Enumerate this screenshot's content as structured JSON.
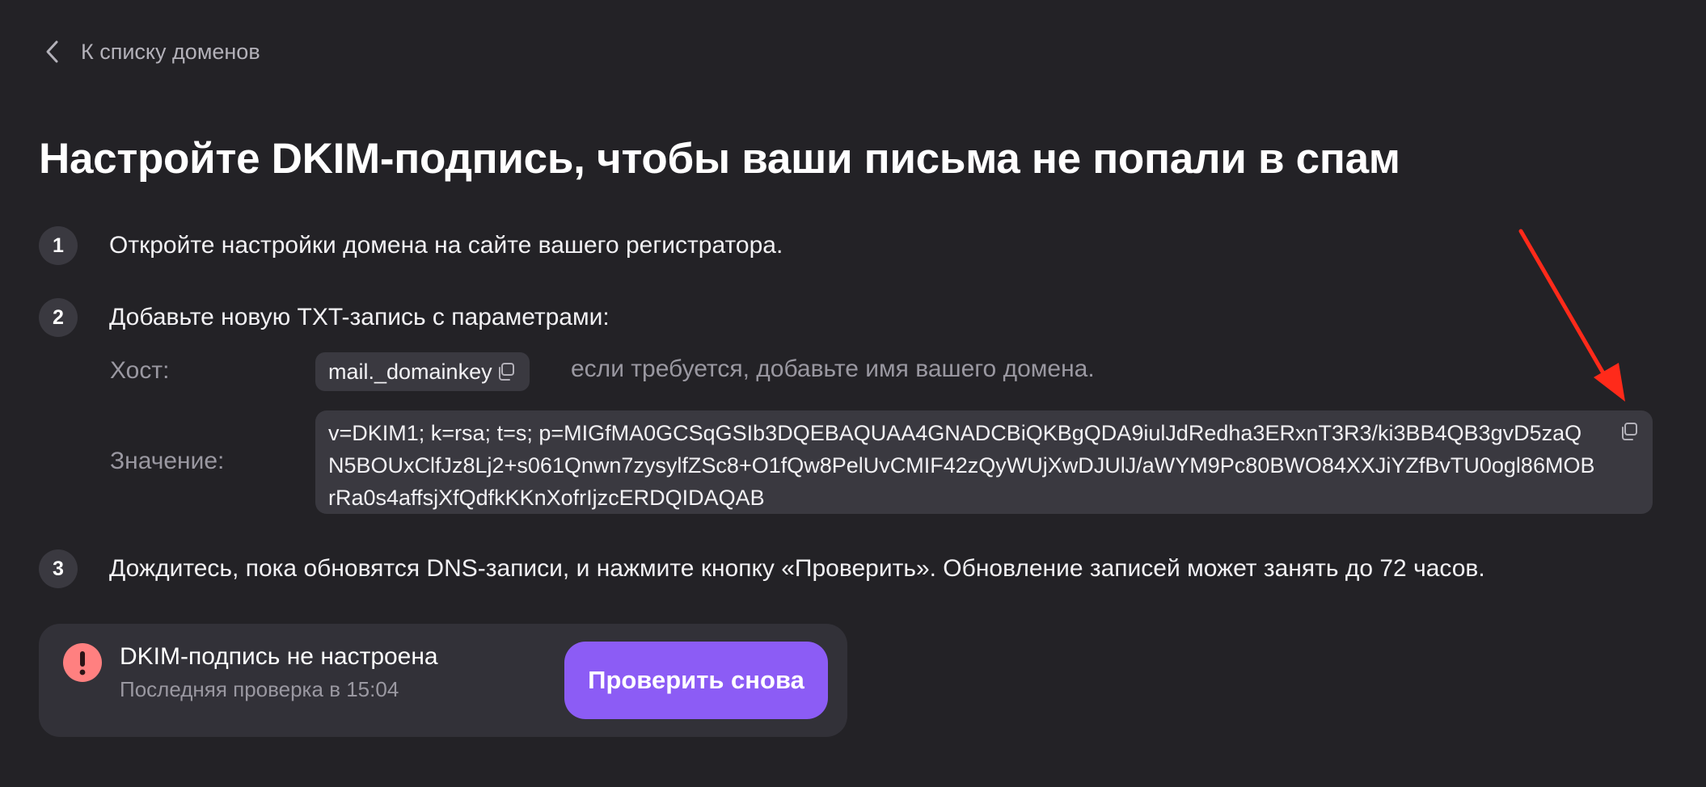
{
  "nav": {
    "back_label": "К списку доменов"
  },
  "page": {
    "title": "Настройте DKIM-подпись, чтобы ваши письма не попали в спам"
  },
  "steps": [
    {
      "number": "1",
      "text": "Откройте настройки домена на сайте вашего регистратора."
    },
    {
      "number": "2",
      "text": "Добавьте новую TXT-запись с параметрами:"
    },
    {
      "number": "3",
      "text": "Дождитесь, пока обновятся DNS-записи, и нажмите кнопку «Проверить». Обновление записей может занять до 72 часов."
    }
  ],
  "record": {
    "host_label": "Хост:",
    "host_value": "mail._domainkey",
    "host_hint": "если требуется, добавьте имя вашего домена.",
    "value_label": "Значение:",
    "value": "v=DKIM1; k=rsa; t=s; p=MIGfMA0GCSqGSIb3DQEBAQUAA4GNADCBiQKBgQDA9iulJdRedha3ERxnT3R3/ki3BB4QB3gvD5zaQN5BOUxClfJz8Lj2+s061Qnwn7zysylfZSc8+O1fQw8PelUvCMIF42zQyWUjXwDJUlJ/aWYM9Pc80BWO84XXJiYZfBvTU0ogl86MOBrRa0s4affsjXfQdfkKKnXofrIjzcERDQIDAQAB"
  },
  "status": {
    "title": "DKIM-подпись не настроена",
    "subtitle": "Последняя проверка в 15:04",
    "button_label": "Проверить снова"
  },
  "icons": {
    "back": "chevron-left-icon",
    "copy": "copy-icon",
    "alert": "exclamation-circle-icon"
  },
  "colors": {
    "background": "#232226",
    "surface": "#3a3940",
    "card": "#323138",
    "accent": "#8c5cf5",
    "error": "#ff8080",
    "annotation": "#ff2a1a"
  }
}
